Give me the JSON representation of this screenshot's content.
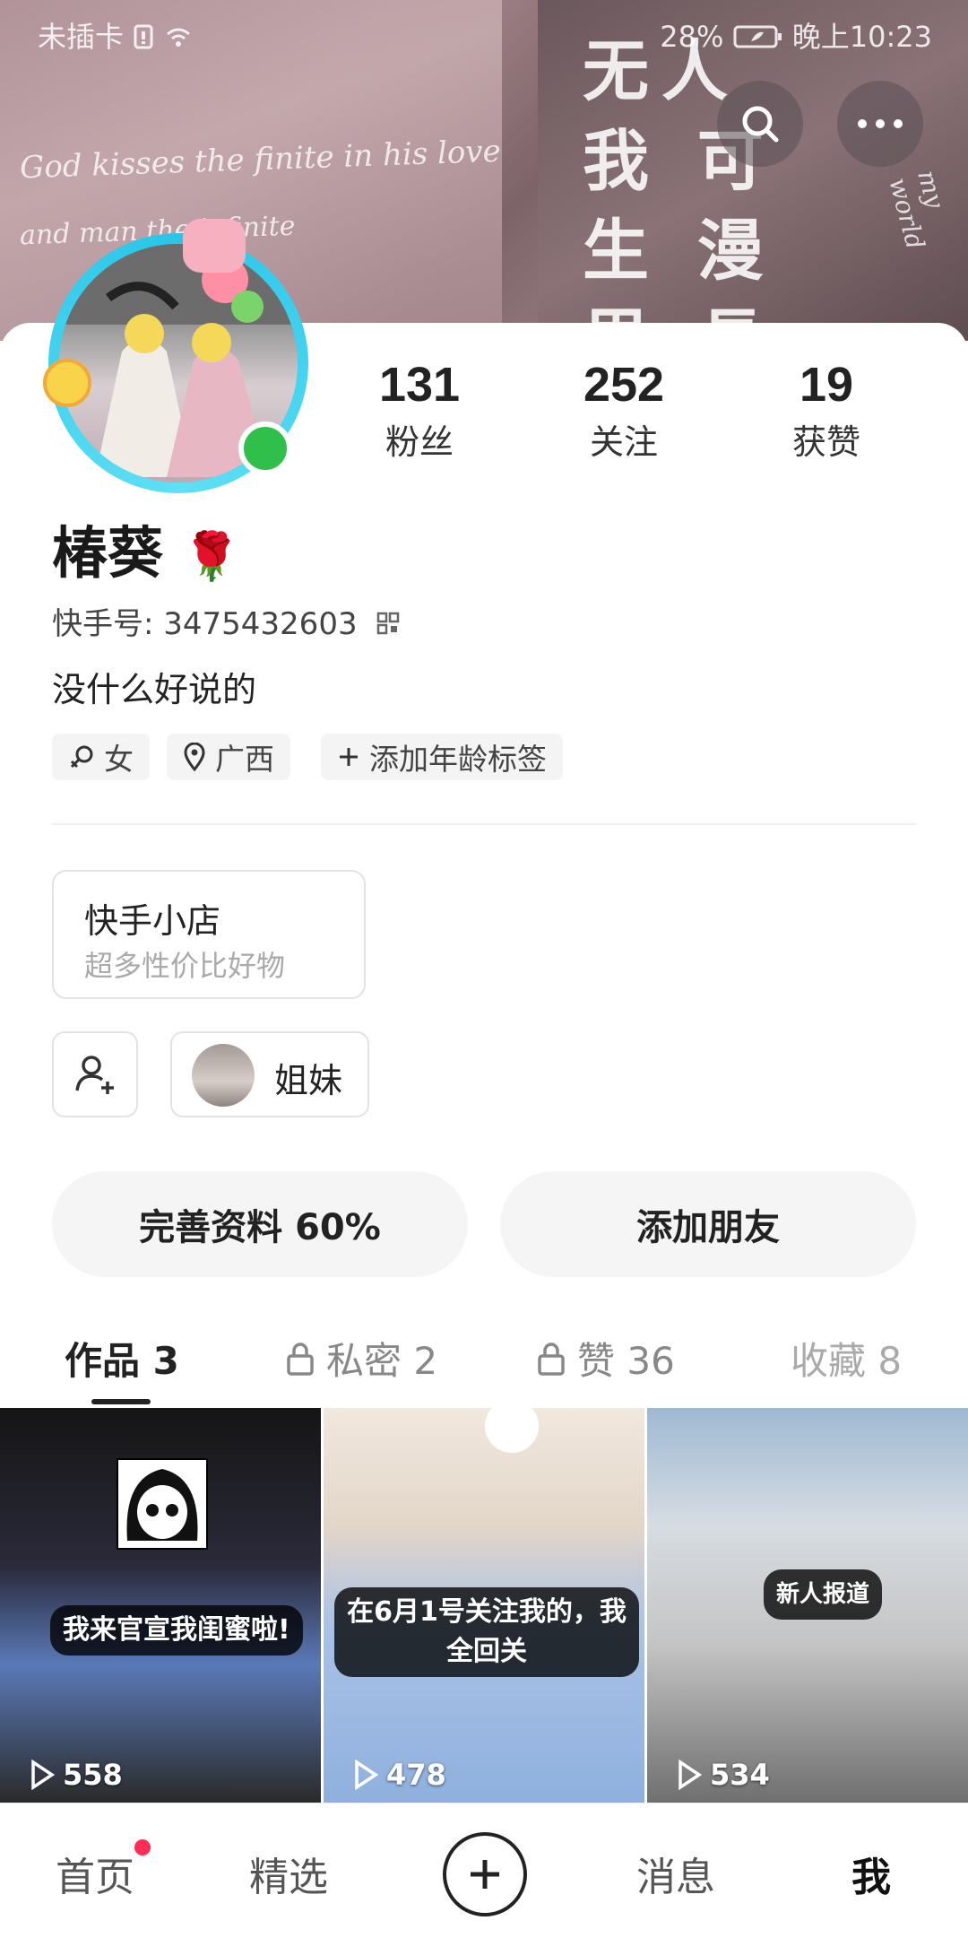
{
  "status_bar": {
    "carrier": "未插卡",
    "battery": "28%",
    "time": "晚上10:23"
  },
  "banner": {
    "quote_line1": "God kisses the finite in his love",
    "quote_line2": "and man the infinite",
    "chinese_text": "无人 我 可 生 漫 里 長 替 的",
    "side_text": "my world"
  },
  "stats": [
    {
      "value": "131",
      "label": "粉丝"
    },
    {
      "value": "252",
      "label": "关注"
    },
    {
      "value": "19",
      "label": "获赞"
    }
  ],
  "profile": {
    "name": "椿葵",
    "name_emoji": "🌹",
    "uid": "快手号: 3475432603",
    "bio": "没什么好说的",
    "tags": [
      "女",
      "广西",
      "添加年龄标签"
    ]
  },
  "shop": {
    "title": "快手小店",
    "subtitle": "超多性价比好物"
  },
  "group": {
    "label": "姐妹"
  },
  "actions": {
    "complete_profile": "完善资料 60%",
    "add_friends": "添加朋友"
  },
  "tabs": [
    {
      "label": "作品 3",
      "locked": false,
      "active": true
    },
    {
      "label": "私密 2",
      "locked": true,
      "active": false
    },
    {
      "label": "赞 36",
      "locked": true,
      "active": false
    },
    {
      "label": "收藏 8",
      "locked": false,
      "active": false
    }
  ],
  "videos": [
    {
      "caption": "我来官宣我闺蜜啦!",
      "plays": "558"
    },
    {
      "caption": "在6月1号关注我的，我全回关",
      "plays": "478"
    },
    {
      "caption": "新人报道",
      "plays": "534"
    }
  ],
  "bottom_nav": [
    "首页",
    "精选",
    "消息",
    "我"
  ],
  "colors": {
    "accent_ring": "#29c5e8",
    "online": "#2fbf4a",
    "badge": "#ff2d55"
  }
}
